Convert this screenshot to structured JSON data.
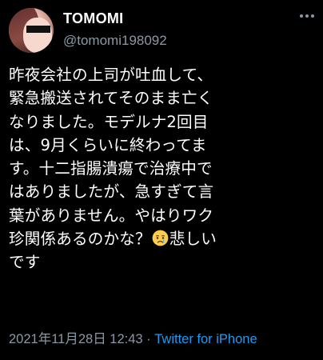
{
  "author": {
    "display_name": "TOMOMI",
    "handle": "@tomomi198092"
  },
  "tweet": {
    "lines": [
      "昨夜会社の上司が吐血して、",
      "緊急搬送されてそのまま亡く",
      "なりました。モデルナ2回目",
      "は、9月くらいに終わってま",
      "す。十二指腸潰瘍で治療中で",
      "はありましたが、急すぎて言",
      "葉がありません。やはりワク",
      "珍関係あるのかな？",
      "悲しい",
      "です"
    ],
    "emoji_icon": "crying-face-icon"
  },
  "meta": {
    "timestamp": "2021年11月28日 12:43",
    "separator": "·",
    "source": "Twitter for iPhone"
  },
  "colors": {
    "background": "#000000",
    "text": "#ffffff",
    "secondary": "#8b98a5",
    "link": "#1d9bf0"
  }
}
